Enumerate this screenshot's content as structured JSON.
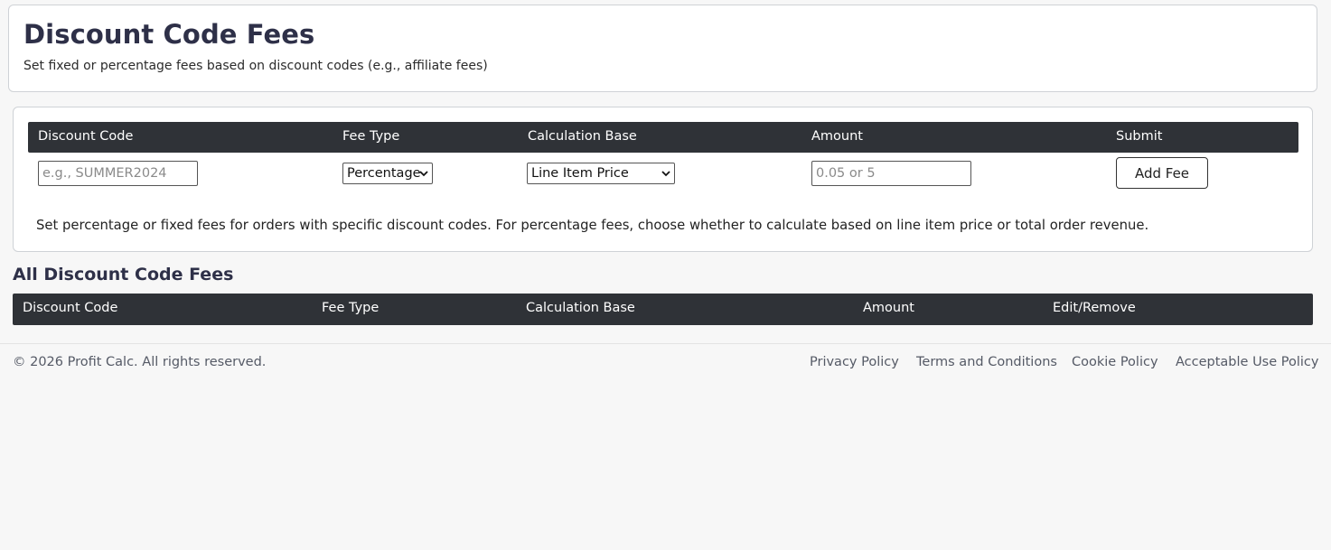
{
  "header": {
    "title": "Discount Code Fees",
    "subtitle": "Set fixed or percentage fees based on discount codes (e.g., affiliate fees)"
  },
  "form": {
    "columns": [
      "Discount Code",
      "Fee Type",
      "Calculation Base",
      "Amount",
      "Submit"
    ],
    "discount_code": {
      "value": "",
      "placeholder": "e.g., SUMMER2024"
    },
    "fee_type": {
      "selected": "Percentage"
    },
    "calculation_base": {
      "selected": "Line Item Price"
    },
    "amount": {
      "value": "",
      "placeholder": "0.05 or 5"
    },
    "submit_label": "Add Fee",
    "note": "Set percentage or fixed fees for orders with specific discount codes. For percentage fees, choose whether to calculate based on line item price or total order revenue."
  },
  "list": {
    "title": "All Discount Code Fees",
    "columns": [
      "Discount Code",
      "Fee Type",
      "Calculation Base",
      "Amount",
      "Edit/Remove"
    ],
    "rows": []
  },
  "footer": {
    "copyright": "© 2026 Profit Calc. All rights reserved.",
    "links": [
      "Privacy Policy",
      "Terms and Conditions",
      "Cookie Policy",
      "Acceptable Use Policy"
    ]
  }
}
